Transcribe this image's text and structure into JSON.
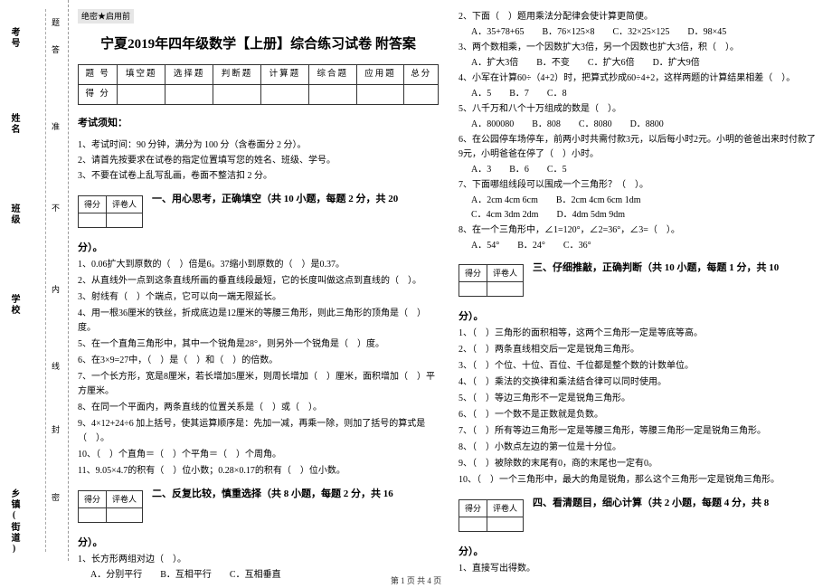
{
  "secret": "绝密★启用前",
  "page_title": "宁夏2019年四年级数学【上册】综合练习试卷 附答案",
  "score_table": {
    "headers": [
      "题 号",
      "填空题",
      "选择题",
      "判断题",
      "计算题",
      "综合题",
      "应用题",
      "总分"
    ],
    "row_label": "得 分"
  },
  "notice_head": "考试须知：",
  "notices": [
    "1、考试时间：90 分钟，满分为 100 分（含卷面分 2 分）。",
    "2、请首先按要求在试卷的指定位置填写您的姓名、班级、学号。",
    "3、不要在试卷上乱写乱画，卷面不整洁扣 2 分。"
  ],
  "scorer_labels": [
    "得分",
    "评卷人"
  ],
  "sections": {
    "s1": {
      "title": "一、用心思考，正确填空（共 10 小题，每题 2 分，共 20",
      "tail": "分）。"
    },
    "s2": {
      "title": "二、反复比较，慎重选择（共 8 小题，每题 2 分，共 16",
      "tail": "分）。"
    },
    "s3": {
      "title": "三、仔细推敲，正确判断（共 10 小题，每题 1 分，共 10",
      "tail": "分）。"
    },
    "s4": {
      "title": "四、看清题目，细心计算（共 2 小题，每题 4 分，共 8",
      "tail": "分）。"
    }
  },
  "q1": [
    "1、0.06扩大到原数的（　）倍是6。37缩小到原数的（　）是0.37。",
    "2、从直线外一点到这条直线所画的垂直线段最短，它的长度叫做这点到直线的（　）。",
    "3、射线有（　）个端点，它可以向一端无限延长。",
    "4、用一根36厘米的铁丝，折成底边是12厘米的等腰三角形，则此三角形的顶角是（　）度。",
    "5、在一个直角三角形中，其中一个锐角是28°，则另外一个锐角是（　）度。",
    "6、在3×9=27中，（　）是（　）和（　）的倍数。",
    "7、一个长方形，宽是8厘米，若长增加5厘米，则周长增加（　）厘米，面积增加（　）平方厘米。",
    "8、在同一个平面内，两条直线的位置关系是（　）或（　）。",
    "9、4×12+24÷6 加上括号，使其运算顺序是：先加一减，再乘一除，则加了括号的算式是（　）。",
    "10、（　）个直角＝（　）个平角＝（　）个周角。",
    "11、9.05×4.7的积有（　）位小数；0.28×0.17的积有（　）位小数。"
  ],
  "q2": [
    {
      "stem": "1、长方形两组对边（　）。",
      "opts": [
        "A．分别平行",
        "B．互相平行",
        "C．互相垂直"
      ]
    },
    {
      "stem": "2、下面（　）题用乘法分配律会使计算更简便。",
      "opts": [
        "A．35+78+65",
        "B．76×125×8",
        "C．32×25×125",
        "D．98×45"
      ]
    },
    {
      "stem": "3、两个数相乘，一个因数扩大3倍，另一个因数也扩大3倍，积（　）。",
      "opts": [
        "A．扩大3倍",
        "B．不变",
        "C．扩大6倍",
        "D．扩大9倍"
      ]
    },
    {
      "stem": "4、小军在计算60÷（4+2）时，把算式抄成60÷4+2，这样两题的计算结果相差（　）。",
      "opts": [
        "A．5",
        "B．7",
        "C．8"
      ]
    },
    {
      "stem": "5、八千万和八个十万组成的数是（　）。",
      "opts": [
        "A．800080",
        "B．808",
        "C．8080",
        "D．8800"
      ]
    },
    {
      "stem": "6、在公园停车场停车，前两小时共需付款3元，以后每小时2元。小明的爸爸出来时付款了9元，小明爸爸在停了（　）小时。",
      "opts": [
        "A．3",
        "B．6",
        "C．5"
      ]
    },
    {
      "stem": "7、下面哪组线段可以围成一个三角形？（　）。",
      "opts": [
        "A．2cm 4cm 6cm",
        "B．2cm 4cm 6cm 1dm",
        "C．4cm 3dm 2dm",
        "D．4dm 5dm 9dm"
      ]
    },
    {
      "stem": "8、在一个三角形中，∠1=120°，∠2=36°，∠3=（　）。",
      "opts": [
        "A．54°",
        "B．24°",
        "C．36°"
      ]
    }
  ],
  "q3": [
    "1、（　）三角形的面积相等，这两个三角形一定是等底等高。",
    "2、（　）两条直线相交后一定是锐角三角形。",
    "3、（　）个位、十位、百位、千位都是整个数的计数单位。",
    "4、（　）乘法的交换律和乘法结合律可以同时使用。",
    "5、（　）等边三角形不一定是锐角三角形。",
    "6、（　）一个数不是正数就是负数。",
    "7、（　）所有等边三角形一定是等腰三角形，等腰三角形一定是锐角三角形。",
    "8、（　）小数点左边的第一位是十分位。",
    "9、（　）被除数的末尾有0，商的末尾也一定有0。",
    "10、（　）一个三角形中，最大的角是锐角，那么这个三角形一定是锐角三角形。"
  ],
  "q4": [
    "1、直接写出得数。"
  ],
  "binding": {
    "f_number": "考号",
    "f_name": "姓名",
    "f_class": "班级",
    "f_school": "学校",
    "f_town": "乡镇(街道)",
    "warn_top": "答",
    "warn_2": "准",
    "warn_3": "不",
    "warn_4": "内",
    "warn_5": "线",
    "warn_6": "封",
    "warn_7": "题",
    "warn_8": "密"
  },
  "footer": "第 1 页 共 4 页"
}
